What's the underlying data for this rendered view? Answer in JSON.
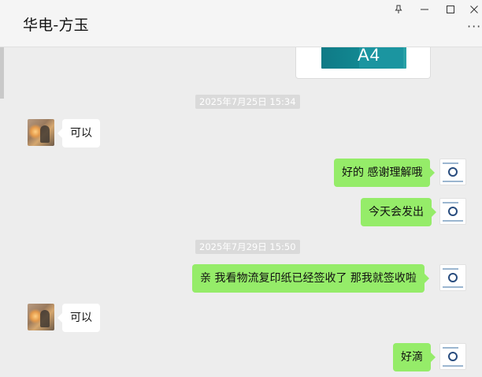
{
  "header": {
    "title": "华电-方玉",
    "more_label": "···"
  },
  "chat": {
    "image_label": "A4",
    "messages": [
      {
        "type": "timestamp",
        "text": "2025年7月25日 15:34"
      },
      {
        "type": "incoming",
        "text": "可以"
      },
      {
        "type": "outgoing",
        "text": "好的 感谢理解哦"
      },
      {
        "type": "outgoing",
        "text": "今天会发出"
      },
      {
        "type": "timestamp",
        "text": "2025年7月29日 15:50"
      },
      {
        "type": "outgoing",
        "text": "亲  我看物流复印纸已经签收了  那我就签收啦"
      },
      {
        "type": "incoming",
        "text": "可以"
      },
      {
        "type": "outgoing",
        "text": "好滴"
      }
    ]
  },
  "colors": {
    "outgoing_bubble": "#95ec69",
    "incoming_bubble": "#ffffff",
    "background": "#ededed",
    "timestamp_bg": "#dadada"
  },
  "icons": [
    "pin-icon",
    "minimize-icon",
    "maximize-icon",
    "close-icon",
    "more-icon"
  ]
}
